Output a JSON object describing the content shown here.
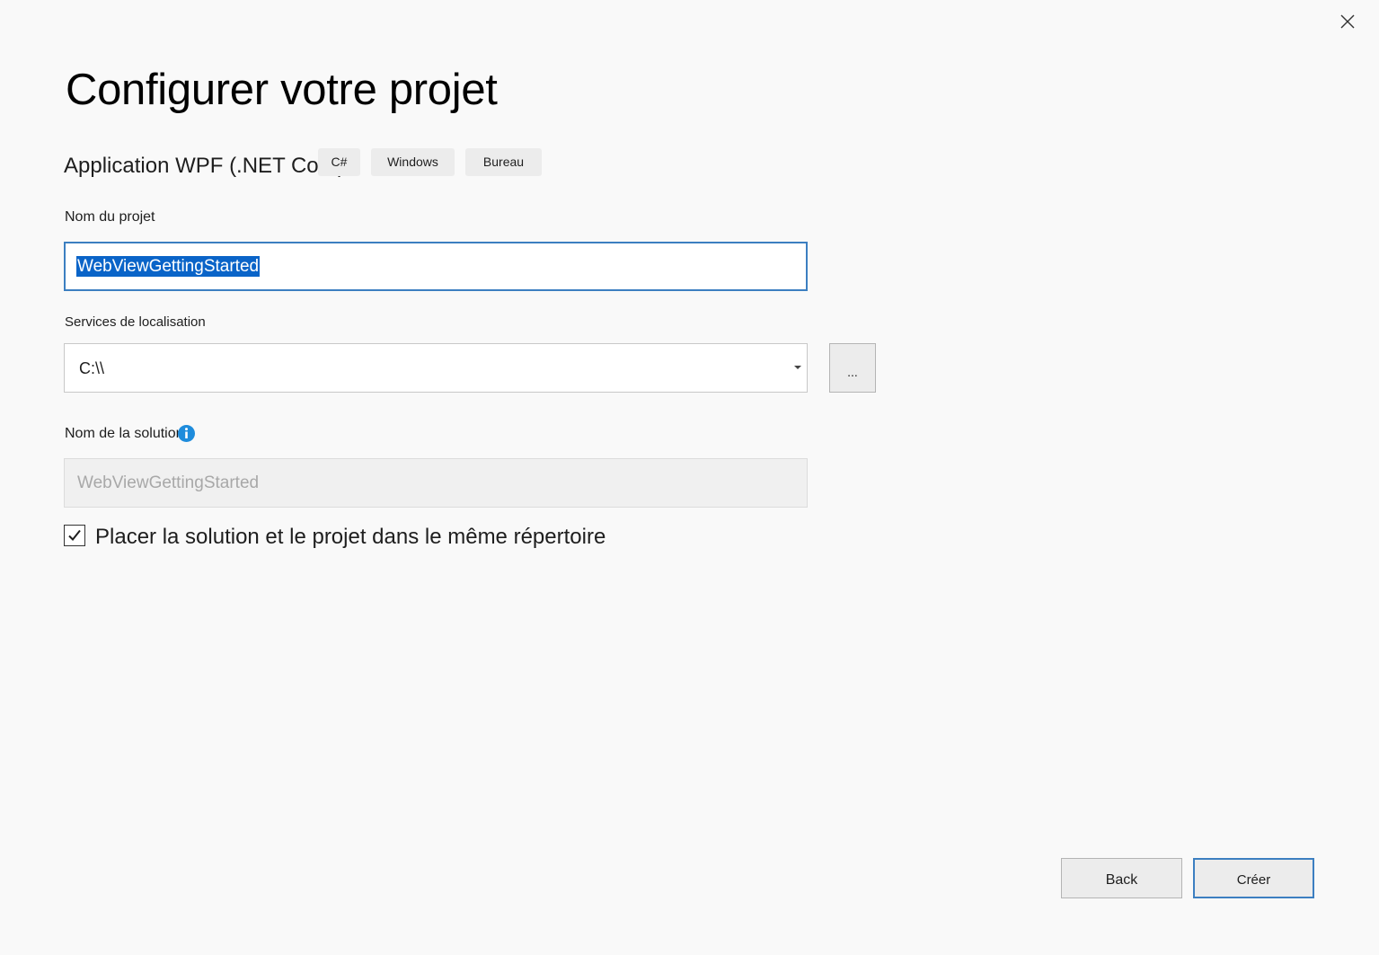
{
  "dialog": {
    "title": "Configurer votre projet",
    "close_icon": "close-icon"
  },
  "template": {
    "name": "Application WPF (.NET Core)",
    "tags": [
      "C#",
      "Windows",
      "Bureau"
    ]
  },
  "project_name": {
    "label": "Nom du projet",
    "value": "WebViewGettingStarted"
  },
  "location": {
    "label": "Services de localisation",
    "value": "C:\\\\",
    "browse_label": "..."
  },
  "solution_name": {
    "label": "Nom de la solution",
    "value": "WebViewGettingStarted",
    "info_icon": "info-icon"
  },
  "same_directory": {
    "label": "Placer la solution et le projet dans le même répertoire",
    "checked": true
  },
  "footer": {
    "back_label": "Back",
    "create_label": "Créer"
  },
  "colors": {
    "focus_border": "#3c7fc1",
    "selection": "#0a64c8",
    "info": "#1e8cdc"
  }
}
